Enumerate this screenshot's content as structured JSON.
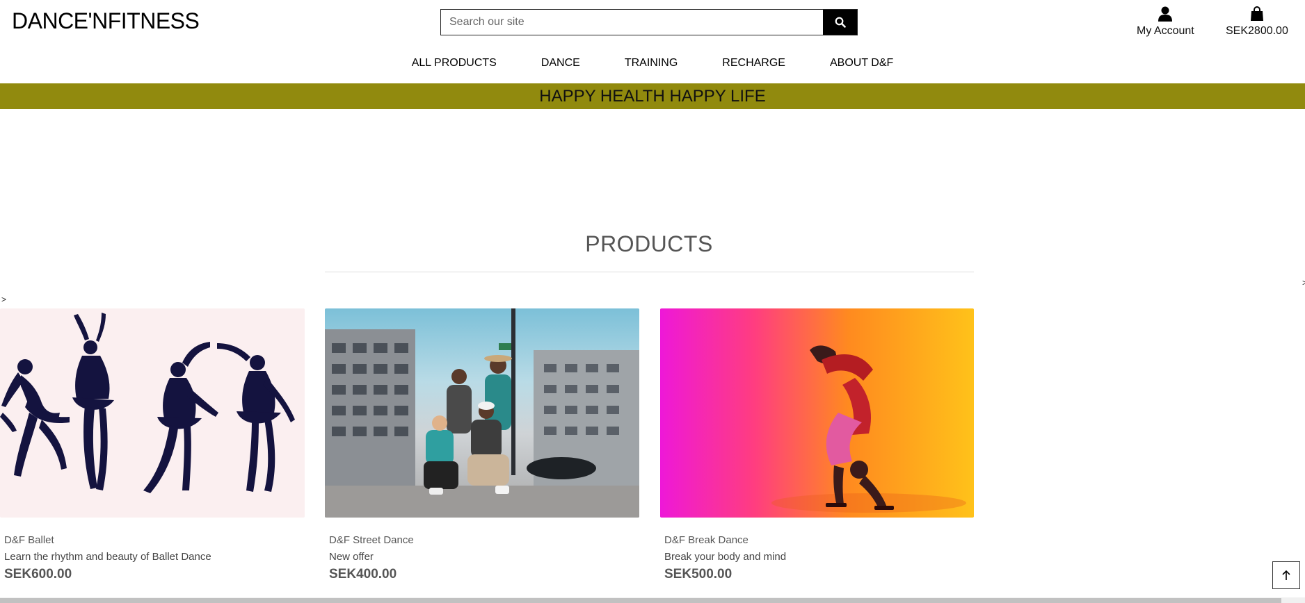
{
  "header": {
    "logo": "DANCE'NFITNESS",
    "search_placeholder": "Search our site",
    "account_label": "My Account",
    "cart_total": "SEK2800.00"
  },
  "nav": {
    "items": [
      "ALL PRODUCTS",
      "DANCE",
      "TRAINING",
      "RECHARGE",
      "ABOUT D&F"
    ]
  },
  "banner": {
    "text": "HAPPY HEALTH HAPPY LIFE"
  },
  "products": {
    "title": "PRODUCTS",
    "prev_arrow": ">",
    "next_arrow": ">",
    "items": [
      {
        "name": "D&F Ballet",
        "desc": "Learn the rhythm and beauty of Ballet Dance",
        "price": "SEK600.00"
      },
      {
        "name": "D&F Street Dance",
        "desc": "New offer",
        "price": "SEK400.00"
      },
      {
        "name": "D&F Break Dance",
        "desc": "Break your body and mind",
        "price": "SEK500.00"
      }
    ]
  },
  "colors": {
    "banner": "#918a0e",
    "ballet_bg": "#fbeff0",
    "silhouette": "#14133f"
  },
  "icons": [
    "search-icon",
    "user-icon",
    "shopping-bag-icon",
    "arrow-up-icon"
  ]
}
